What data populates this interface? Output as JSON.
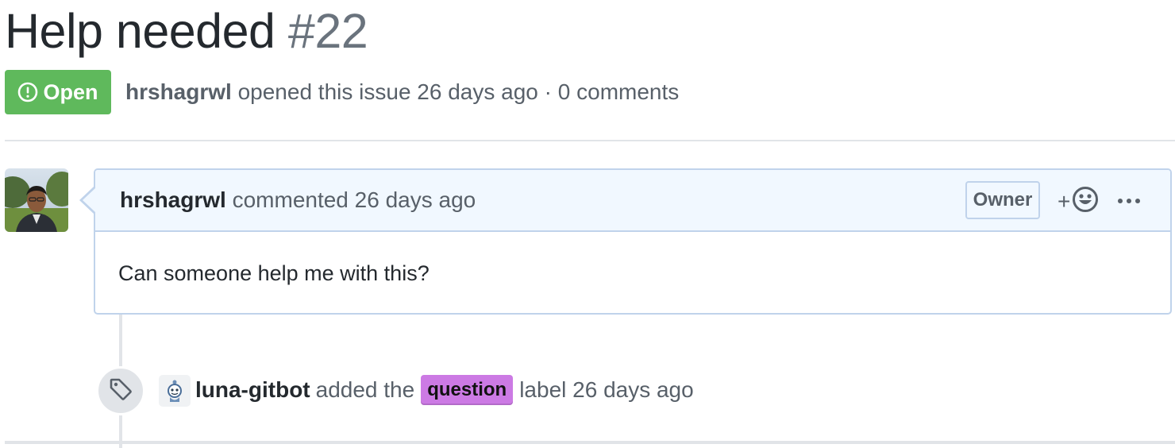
{
  "issue": {
    "title": "Help needed",
    "number": "#22",
    "state": "Open",
    "author": "hrshagrwl",
    "meta_opened": "opened this issue 26 days ago",
    "meta_sep": "·",
    "comments": "0 comments"
  },
  "comment": {
    "author": "hrshagrwl",
    "action": "commented 26 days ago",
    "role_badge": "Owner",
    "reaction_plus": "+",
    "body": "Can someone help me with this?"
  },
  "timeline_event": {
    "actor": "luna-gitbot",
    "action": "added the",
    "label": "question",
    "label_color": "#cc7ae4",
    "suffix": "label 26 days ago"
  },
  "colors": {
    "open_state": "#5fb95c",
    "comment_header_bg": "#f1f8ff",
    "comment_border": "#c0d3eb"
  },
  "icons": [
    "issue-opened-icon",
    "smiley-icon",
    "kebab-horizontal-icon",
    "tag-icon",
    "bot-avatar"
  ]
}
